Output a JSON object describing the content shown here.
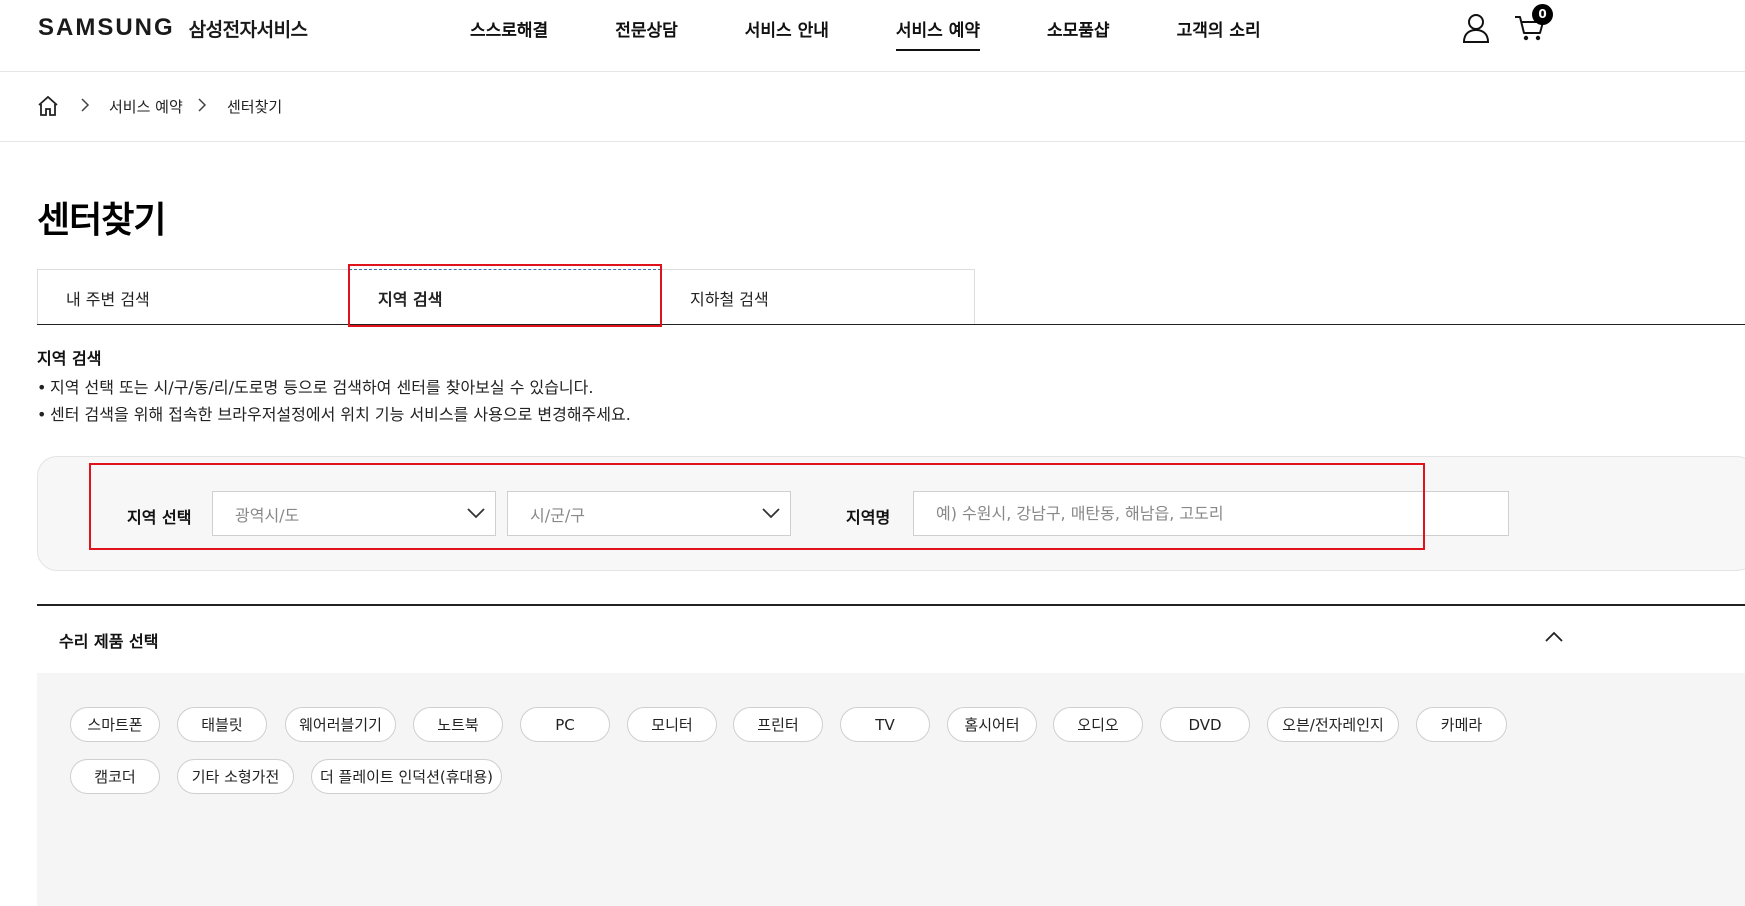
{
  "header": {
    "brand": "SAMSUNG",
    "brand_sub": "삼성전자서비스",
    "nav": [
      "스스로해결",
      "전문상담",
      "서비스 안내",
      "서비스 예약",
      "소모품샵",
      "고객의 소리"
    ],
    "active_nav": "서비스 예약",
    "cart_count": "0"
  },
  "breadcrumb": {
    "items": [
      "서비스 예약",
      "센터찾기"
    ]
  },
  "page": {
    "title": "센터찾기"
  },
  "tabs": [
    {
      "label": "내 주변 검색",
      "active": false
    },
    {
      "label": "지역 검색",
      "active": true
    },
    {
      "label": "지하철 검색",
      "active": false
    }
  ],
  "description": {
    "title": "지역 검색",
    "bullets": [
      "지역 선택 또는 시/구/동/리/도로명 등으로 검색하여 센터를 찾아보실 수 있습니다.",
      "센터 검색을 위해 접속한 브라우저설정에서 위치 기능 서비스를 사용으로 변경해주세요."
    ]
  },
  "search": {
    "region_label": "지역 선택",
    "province_select": "광역시/도",
    "city_select": "시/군/구",
    "area_label": "지역명",
    "area_placeholder": "예) 수원시, 강남구, 매탄동, 해남읍, 고도리",
    "area_value": ""
  },
  "products": {
    "title": "수리 제품 선택",
    "chips": [
      "스마트폰",
      "태블릿",
      "웨어러블기기",
      "노트북",
      "PC",
      "모니터",
      "프린터",
      "TV",
      "홈시어터",
      "오디오",
      "DVD",
      "오븐/전자레인지",
      "카메라",
      "캠코더",
      "기타 소형가전",
      "더 플레이트 인덕션(휴대용)"
    ]
  },
  "colors": {
    "highlight": "#e0121b",
    "text": "#111111",
    "panel": "#f7f7f7"
  }
}
